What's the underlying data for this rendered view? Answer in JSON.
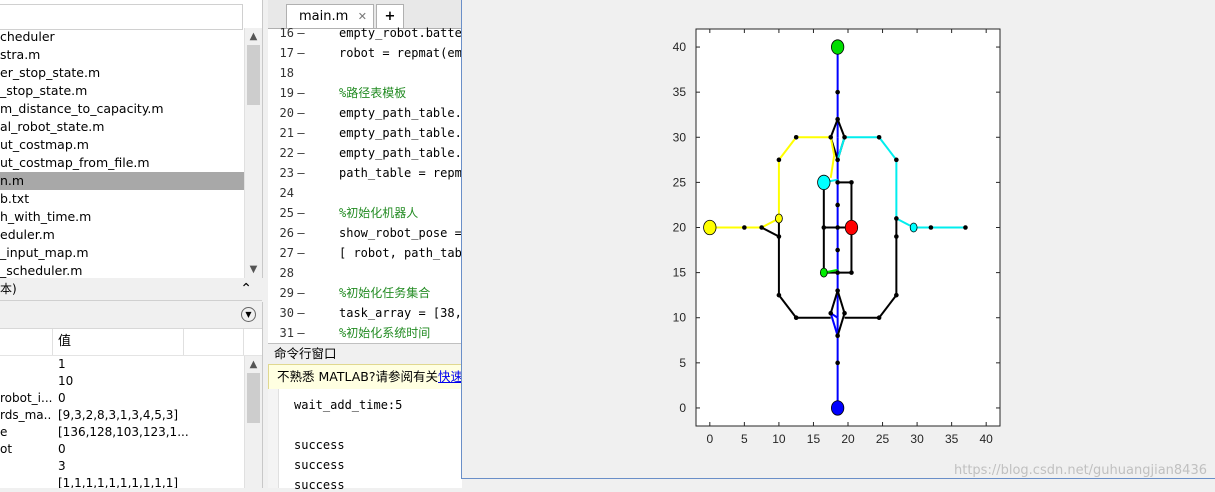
{
  "file_browser": {
    "files": [
      "cheduler",
      "stra.m",
      "er_stop_state.m",
      "_stop_state.m",
      "m_distance_to_capacity.m",
      "al_robot_state.m",
      "ut_costmap.m",
      "ut_costmap_from_file.m",
      "n.m",
      "b.txt",
      "h_with_time.m",
      "eduler.m",
      "_input_map.m",
      "_scheduler.m"
    ],
    "selected_index": 8
  },
  "details_panel": {
    "label": "本)"
  },
  "workspace": {
    "value_header": "值",
    "rows": [
      {
        "name": "",
        "value": "1"
      },
      {
        "name": "",
        "value": "10"
      },
      {
        "name": "robot_i...",
        "value": "0"
      },
      {
        "name": "rds_ma...",
        "value": "[9,3,2,8,3,1,3,4,5,3]"
      },
      {
        "name": "e",
        "value": "[136,128,103,123,1..."
      },
      {
        "name": "ot",
        "value": "0"
      },
      {
        "name": "",
        "value": "3"
      },
      {
        "name": "",
        "value": "[1,1,1,1,1,1,1,1,1,1]"
      }
    ]
  },
  "editor": {
    "tab_label": "main.m",
    "add_tab_label": "+",
    "lines": [
      {
        "num": "16",
        "text": "empty_robot.batter",
        "comment": false
      },
      {
        "num": "17",
        "text": "robot = repmat(emp",
        "comment": false
      },
      {
        "num": "18",
        "text": "",
        "comment": false
      },
      {
        "num": "19",
        "text": "%路径表模板",
        "comment": true
      },
      {
        "num": "20",
        "text": "empty_path_table.s",
        "comment": false
      },
      {
        "num": "21",
        "text": "empty_path_table.g",
        "comment": false
      },
      {
        "num": "22",
        "text": "empty_path_table.r",
        "comment": false
      },
      {
        "num": "23",
        "text": "path_table = repma",
        "comment": false
      },
      {
        "num": "24",
        "text": "",
        "comment": false
      },
      {
        "num": "25",
        "text": "%初始化机器人",
        "comment": true
      },
      {
        "num": "26",
        "text": "show_robot_pose =",
        "comment": false
      },
      {
        "num": "27",
        "text": "[ robot, path_tabl",
        "comment": false
      },
      {
        "num": "28",
        "text": "",
        "comment": false
      },
      {
        "num": "29",
        "text": "%初始化任务集合",
        "comment": true
      },
      {
        "num": "30",
        "text": "task_array = [38,",
        "comment": false
      },
      {
        "num": "31",
        "text": "%初始化系统时间",
        "comment": true
      }
    ]
  },
  "command_window": {
    "title": "命令行窗口",
    "note_prefix": "不熟悉 MATLAB?请参阅有关",
    "note_link": "快速入",
    "output": [
      "wait_add_time:5",
      "",
      "success",
      "success",
      "success"
    ]
  },
  "watermark": "https://blog.csdn.net/guhuangjian8436",
  "chart_data": {
    "type": "scatter",
    "title": "",
    "xlabel": "",
    "ylabel": "",
    "xlim": [
      -2,
      42
    ],
    "ylim": [
      -2,
      42
    ],
    "xticks": [
      0,
      5,
      10,
      15,
      20,
      25,
      30,
      35,
      40
    ],
    "yticks": [
      0,
      5,
      10,
      15,
      20,
      25,
      30,
      35,
      40
    ],
    "grid": false,
    "segments": [
      {
        "color": "#0000ff",
        "from": [
          18.5,
          0
        ],
        "to": [
          18.5,
          10
        ]
      },
      {
        "color": "#0000ff",
        "from": [
          18.5,
          10
        ],
        "to": [
          18.5,
          30
        ]
      },
      {
        "color": "#0000ff",
        "from": [
          18.5,
          30
        ],
        "to": [
          18.5,
          40
        ]
      },
      {
        "color": "#0000ff",
        "from": [
          18.5,
          10
        ],
        "to": [
          17.5,
          10.5
        ]
      },
      {
        "color": "#0000ff",
        "from": [
          17.5,
          10.5
        ],
        "to": [
          18.5,
          8
        ]
      },
      {
        "color": "#000000",
        "from": [
          17.5,
          10.5
        ],
        "to": [
          18.5,
          13
        ]
      },
      {
        "color": "#000000",
        "from": [
          19.5,
          10.5
        ],
        "to": [
          18.5,
          8
        ]
      },
      {
        "color": "#000000",
        "from": [
          19.5,
          10.5
        ],
        "to": [
          18.5,
          13
        ]
      },
      {
        "color": "#000000",
        "from": [
          17.5,
          30
        ],
        "to": [
          18.5,
          32
        ]
      },
      {
        "color": "#000000",
        "from": [
          19.5,
          30
        ],
        "to": [
          18.5,
          32
        ]
      },
      {
        "color": "#000000",
        "from": [
          17.5,
          30
        ],
        "to": [
          18.5,
          27.5
        ]
      },
      {
        "color": "#000000",
        "from": [
          19.5,
          30
        ],
        "to": [
          18.5,
          27.5
        ]
      },
      {
        "color": "#000000",
        "from": [
          10,
          19
        ],
        "to": [
          10,
          12.5
        ]
      },
      {
        "color": "#000000",
        "from": [
          10,
          12.5
        ],
        "to": [
          12.5,
          10
        ]
      },
      {
        "color": "#000000",
        "from": [
          12.5,
          10
        ],
        "to": [
          17.5,
          10
        ]
      },
      {
        "color": "#000000",
        "from": [
          19.5,
          10
        ],
        "to": [
          24.5,
          10
        ]
      },
      {
        "color": "#000000",
        "from": [
          24.5,
          10
        ],
        "to": [
          27,
          12.5
        ]
      },
      {
        "color": "#000000",
        "from": [
          27,
          12.5
        ],
        "to": [
          27,
          19
        ]
      },
      {
        "color": "#000000",
        "from": [
          27,
          19
        ],
        "to": [
          27,
          21
        ]
      },
      {
        "color": "#000000",
        "from": [
          10,
          19
        ],
        "to": [
          7.5,
          20
        ]
      },
      {
        "color": "#000000",
        "from": [
          10,
          19
        ],
        "to": [
          10,
          21
        ]
      },
      {
        "color": "#000000",
        "from": [
          16.5,
          15
        ],
        "to": [
          16.5,
          25
        ]
      },
      {
        "color": "#000000",
        "from": [
          16.5,
          15
        ],
        "to": [
          20.5,
          15
        ]
      },
      {
        "color": "#000000",
        "from": [
          20.5,
          15
        ],
        "to": [
          20.5,
          25
        ]
      },
      {
        "color": "#000000",
        "from": [
          18.5,
          25
        ],
        "to": [
          20.5,
          25
        ]
      },
      {
        "color": "#000000",
        "from": [
          16.5,
          20
        ],
        "to": [
          20.5,
          20
        ]
      },
      {
        "color": "#00dd00",
        "from": [
          16.5,
          15
        ],
        "to": [
          18.5,
          15.3
        ]
      },
      {
        "color": "#ffff00",
        "from": [
          0,
          20
        ],
        "to": [
          7.5,
          20
        ]
      },
      {
        "color": "#ffff00",
        "from": [
          7.5,
          20
        ],
        "to": [
          10,
          21
        ]
      },
      {
        "color": "#ffff00",
        "from": [
          10,
          21
        ],
        "to": [
          10,
          27.5
        ]
      },
      {
        "color": "#ffff00",
        "from": [
          10,
          27.5
        ],
        "to": [
          12.5,
          30
        ]
      },
      {
        "color": "#ffff00",
        "from": [
          12.5,
          30
        ],
        "to": [
          17.5,
          30
        ]
      },
      {
        "color": "#ffff00",
        "from": [
          17.5,
          30
        ],
        "to": [
          18,
          28
        ]
      },
      {
        "color": "#ffff00",
        "from": [
          18,
          28
        ],
        "to": [
          17.5,
          25.5
        ]
      },
      {
        "color": "#00eeee",
        "from": [
          16.5,
          25
        ],
        "to": [
          18.5,
          25.3
        ]
      },
      {
        "color": "#00eeee",
        "from": [
          18.5,
          27.5
        ],
        "to": [
          19.5,
          30
        ]
      },
      {
        "color": "#00eeee",
        "from": [
          19.5,
          30
        ],
        "to": [
          24.5,
          30
        ]
      },
      {
        "color": "#00eeee",
        "from": [
          24.5,
          30
        ],
        "to": [
          27,
          27.5
        ]
      },
      {
        "color": "#00eeee",
        "from": [
          27,
          27.5
        ],
        "to": [
          27,
          21
        ]
      },
      {
        "color": "#00eeee",
        "from": [
          27,
          21
        ],
        "to": [
          29.5,
          20
        ]
      },
      {
        "color": "#00eeee",
        "from": [
          29.5,
          20
        ],
        "to": [
          37,
          20
        ]
      }
    ],
    "nodes": [
      [
        18.5,
        5
      ],
      [
        18.5,
        8
      ],
      [
        18.5,
        13
      ],
      [
        18.5,
        15
      ],
      [
        18.5,
        17.5
      ],
      [
        18.5,
        20
      ],
      [
        18.5,
        22.5
      ],
      [
        18.5,
        25
      ],
      [
        18.5,
        27.5
      ],
      [
        18.5,
        32
      ],
      [
        18.5,
        35
      ],
      [
        17.5,
        10.5
      ],
      [
        19.5,
        10.5
      ],
      [
        17.5,
        30
      ],
      [
        19.5,
        30
      ],
      [
        10,
        12.5
      ],
      [
        12.5,
        10
      ],
      [
        24.5,
        10
      ],
      [
        27,
        12.5
      ],
      [
        27,
        19
      ],
      [
        27,
        21
      ],
      [
        27,
        27.5
      ],
      [
        24.5,
        30
      ],
      [
        12.5,
        30
      ],
      [
        10,
        27.5
      ],
      [
        10,
        19
      ],
      [
        7.5,
        20
      ],
      [
        5,
        20
      ],
      [
        32,
        20
      ],
      [
        37,
        20
      ],
      [
        16.5,
        15
      ],
      [
        20.5,
        15
      ],
      [
        20.5,
        25
      ],
      [
        16.5,
        20
      ]
    ],
    "robots": [
      {
        "x": 18.5,
        "y": 40,
        "color": "#00dd00",
        "rx": 0.9,
        "ry": 0.8
      },
      {
        "x": 18.5,
        "y": 0,
        "color": "#0000ff",
        "rx": 0.9,
        "ry": 0.8
      },
      {
        "x": 0,
        "y": 20,
        "color": "#ffff00",
        "rx": 0.9,
        "ry": 0.8
      },
      {
        "x": 16.5,
        "y": 25,
        "color": "#00ffff",
        "rx": 0.9,
        "ry": 0.8
      },
      {
        "x": 20.5,
        "y": 20,
        "color": "#ff0000",
        "rx": 0.9,
        "ry": 0.8
      },
      {
        "x": 10,
        "y": 21,
        "color": "#ffff00",
        "rx": 0.5,
        "ry": 0.5
      },
      {
        "x": 29.5,
        "y": 20,
        "color": "#00ffff",
        "rx": 0.5,
        "ry": 0.5
      },
      {
        "x": 16.5,
        "y": 15,
        "color": "#00ee00",
        "rx": 0.5,
        "ry": 0.5
      }
    ]
  }
}
